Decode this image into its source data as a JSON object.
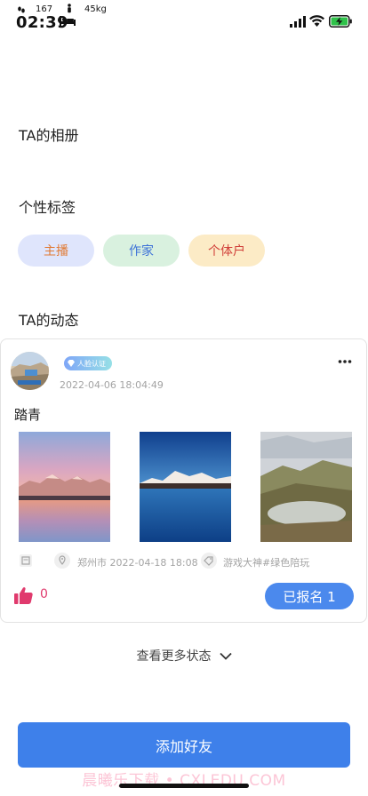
{
  "status_bar": {
    "time": "02:39",
    "steps": "167",
    "weight": "45kg",
    "battery_color": "#2fc24a"
  },
  "sections": {
    "album_title": "TA的相册",
    "tags_title": "个性标签",
    "moments_title": "TA的动态"
  },
  "tags": [
    {
      "label": "主播",
      "bg": "#dfe5fc",
      "color": "#e17a34"
    },
    {
      "label": "作家",
      "bg": "#d9f1df",
      "color": "#3d72d8"
    },
    {
      "label": "个体户",
      "bg": "#fcebc6",
      "color": "#d1403a"
    }
  ],
  "post": {
    "badge_label": "人脸认证",
    "time": "2022-04-06 18:04:49",
    "text": "踏青",
    "photos": [
      "sunset-mountain-lake",
      "blue-lake-snow-mountain",
      "alpine-valley-lake"
    ],
    "location_time": "郑州市 2022-04-18 18:08",
    "activity_tag": "游戏大神#绿色陪玩",
    "like_count": "0",
    "signup_label": "已报名 1",
    "accent_color": "#4b89ed",
    "like_color": "#e03a6d"
  },
  "view_more_label": "查看更多状态",
  "add_friend_label": "添加好友",
  "watermark": "晨曦乐下载 • CXLEDU.COM"
}
